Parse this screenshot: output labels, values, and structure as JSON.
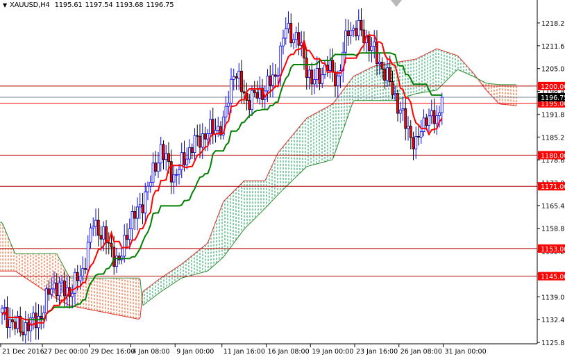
{
  "header": {
    "menu_icon": "triangle-down-icon",
    "symbol": "XAUUSD,H4",
    "open": "1195.61",
    "high": "1197.54",
    "low": "1193.68",
    "close": "1196.75"
  },
  "colors": {
    "up_candle_outline": "#0000ff",
    "down_candle_body": "#ff0000",
    "tenkan": "#ff0000",
    "kijun": "#008000",
    "cloud_bull": "#00a050",
    "cloud_bear": "#ff4500",
    "level_line": "#b00000",
    "level_label_bg": "#ff0000",
    "price_line": "#778899"
  },
  "chart_data": {
    "type": "candlestick",
    "title": "XAUUSD,H4",
    "indicators": [
      "Ichimoku Kinko Hyo (tenkan 9, kijun 26, cloud)"
    ],
    "ylim": [
      1125.85,
      1218.25
    ],
    "y_ticks": [
      "1218.25",
      "1211.65",
      "1205.05",
      "1198.45",
      "1191.85",
      "1185.25",
      "1178.65",
      "1172.05",
      "1165.45",
      "1158.85",
      "1152.25",
      "1145.65",
      "1139.05",
      "1132.45",
      "1125.85"
    ],
    "x_ticks": [
      {
        "bar": 0,
        "label": "21 Dec 2016"
      },
      {
        "bar": 16,
        "label": "27 Dec 00:00"
      },
      {
        "bar": 34,
        "label": "29 Dec 16:00"
      },
      {
        "bar": 50,
        "label": "4 Jan 08:00"
      },
      {
        "bar": 67,
        "label": "9 Jan 00:00"
      },
      {
        "bar": 85,
        "label": "11 Jan 16:00"
      },
      {
        "bar": 102,
        "label": "16 Jan 08:00"
      },
      {
        "bar": 119,
        "label": "19 Jan 00:00"
      },
      {
        "bar": 136,
        "label": "23 Jan 16:00"
      },
      {
        "bar": 153,
        "label": "26 Jan 08:00"
      },
      {
        "bar": 170,
        "label": "31 Jan 00:00"
      }
    ],
    "bar_count": 170,
    "close_path": [
      [
        0,
        1134.5
      ],
      [
        7,
        1129.5
      ],
      [
        15,
        1133.5
      ],
      [
        19,
        1142.5
      ],
      [
        26,
        1140.5
      ],
      [
        31,
        1146.5
      ],
      [
        35,
        1160.6
      ],
      [
        39,
        1156.6
      ],
      [
        45,
        1148.5
      ],
      [
        49,
        1160.6
      ],
      [
        53,
        1164.6
      ],
      [
        57,
        1172.6
      ],
      [
        61,
        1181.7
      ],
      [
        66,
        1173.6
      ],
      [
        73,
        1182.7
      ],
      [
        79,
        1186.7
      ],
      [
        85,
        1188.7
      ],
      [
        89,
        1204.8
      ],
      [
        94,
        1195.8
      ],
      [
        99,
        1197.8
      ],
      [
        105,
        1202.8
      ],
      [
        109,
        1216.8
      ],
      [
        114,
        1212.8
      ],
      [
        119,
        1200.8
      ],
      [
        125,
        1205.8
      ],
      [
        129,
        1201.8
      ],
      [
        133,
        1216.8
      ],
      [
        138,
        1215.8
      ],
      [
        143,
        1209.8
      ],
      [
        149,
        1200.8
      ],
      [
        154,
        1190.7
      ],
      [
        159,
        1182.7
      ],
      [
        163,
        1191.7
      ],
      [
        167,
        1189.7
      ],
      [
        169,
        1196.75
      ]
    ],
    "cloud": [
      {
        "bar": 0,
        "span_a": 1146.5,
        "span_b": 1160.6
      },
      {
        "bar": 5,
        "span_a": 1146.5,
        "span_b": 1151.5
      },
      {
        "bar": 21,
        "span_a": 1138.5,
        "span_b": 1151.5
      },
      {
        "bar": 26,
        "span_a": 1136.5,
        "span_b": 1144.5
      },
      {
        "bar": 53,
        "span_a": 1132.5,
        "span_b": 1144.5
      },
      {
        "bar": 54,
        "span_a": 1140.5,
        "span_b": 1136.5
      },
      {
        "bar": 61,
        "span_a": 1144.5,
        "span_b": 1140.5
      },
      {
        "bar": 69,
        "span_a": 1148.5,
        "span_b": 1144.5
      },
      {
        "bar": 79,
        "span_a": 1154.6,
        "span_b": 1146.5
      },
      {
        "bar": 85,
        "span_a": 1166.6,
        "span_b": 1150.5
      },
      {
        "bar": 93,
        "span_a": 1172.6,
        "span_b": 1158.6
      },
      {
        "bar": 101,
        "span_a": 1172.6,
        "span_b": 1164.6
      },
      {
        "bar": 106,
        "span_a": 1180.7,
        "span_b": 1168.6
      },
      {
        "bar": 117,
        "span_a": 1190.7,
        "span_b": 1176.7
      },
      {
        "bar": 127,
        "span_a": 1194.8,
        "span_b": 1178.7
      },
      {
        "bar": 135,
        "span_a": 1202.8,
        "span_b": 1195.8
      },
      {
        "bar": 143,
        "span_a": 1205.8,
        "span_b": 1195.8
      },
      {
        "bar": 151,
        "span_a": 1206.8,
        "span_b": 1195.8
      },
      {
        "bar": 159,
        "span_a": 1207.8,
        "span_b": 1197.8
      },
      {
        "bar": 167,
        "span_a": 1210.8,
        "span_b": 1198.8
      },
      {
        "bar": 175,
        "span_a": 1208.8,
        "span_b": 1204.8
      },
      {
        "bar": 181,
        "span_a": 1203.8,
        "span_b": 1202.8
      },
      {
        "bar": 186,
        "span_a": 1198.8,
        "span_b": 1200.8
      },
      {
        "bar": 191,
        "span_a": 1194.8,
        "span_b": 1200.4
      },
      {
        "bar": 198,
        "span_a": 1194.3,
        "span_b": 1200.4
      }
    ],
    "levels": [
      {
        "price": 1200.0,
        "label": "1200.00"
      },
      {
        "price": 1195.0,
        "label": "1195.00"
      },
      {
        "price": 1180.0,
        "label": "1180.00"
      },
      {
        "price": 1171.0,
        "label": "1171.00"
      },
      {
        "price": 1153.0,
        "label": "1153.00"
      },
      {
        "price": 1145.0,
        "label": "1145.00"
      }
    ],
    "current_price": {
      "price": 1196.75,
      "label": "1196.75"
    }
  }
}
